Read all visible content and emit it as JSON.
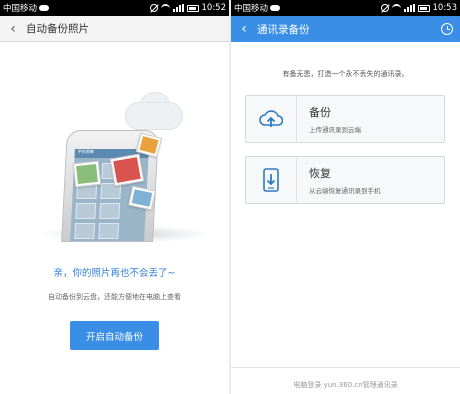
{
  "left": {
    "status": {
      "carrier": "中国移动",
      "time": "10:52"
    },
    "header": {
      "back": "‹",
      "title": "自动备份照片"
    },
    "slogan": "亲，你的照片再也不会丢了~",
    "subline": "自动备份到云盘，还能方便地在电脑上查看",
    "button": "开启自动备份",
    "phone_caption": "手机图库"
  },
  "right": {
    "status": {
      "carrier": "中国移动",
      "time": "10:53"
    },
    "header": {
      "back": "‹",
      "title": "通讯录备份"
    },
    "tagline": "有备无患，打造一个永不丢失的通讯录。",
    "backup": {
      "title": "备份",
      "desc": "上传通讯录到云端"
    },
    "restore": {
      "title": "恢复",
      "desc": "从云端恢复通讯录到手机"
    },
    "footer": "电脑登录 yun.360.cn管理通讯录"
  },
  "colors": {
    "accent": "#3a8ee6",
    "slogan": "#2f7fd6"
  },
  "icons": [
    "back-icon",
    "clock-icon",
    "upload-cloud-icon",
    "download-phone-icon"
  ]
}
